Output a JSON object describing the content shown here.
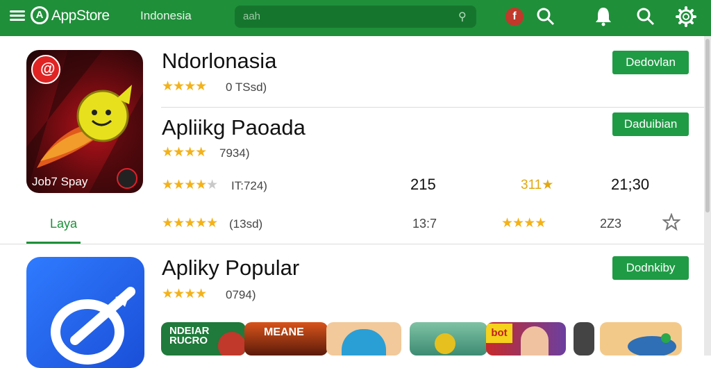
{
  "header": {
    "brand": "AppStore",
    "region": "Indonesia",
    "search_placeholder": "aah"
  },
  "icons": [
    "menu-icon",
    "logo-icon",
    "flag-icon",
    "search-icon",
    "bell-icon",
    "gear-icon",
    "star-icon"
  ],
  "colors": {
    "header": "#1f8f3a",
    "button": "#1f9b45",
    "star": "#f3b21a"
  },
  "apps": [
    {
      "title": "Ndorlonasia",
      "rating_count": "0 TSsd)",
      "button": "Dedovlan"
    },
    {
      "title": "Apliikg Paoada",
      "rating_count": "7934)",
      "button": "Daduibian",
      "icon_text": "Job7 Spay",
      "icon_badge": "@",
      "rows": [
        {
          "rating": "IT:724)",
          "value_a": "215",
          "value_b": "311★",
          "value_c": "21;30"
        },
        {
          "rating": "(13sd)",
          "value_a": "13:7",
          "value_c": "2Z3"
        }
      ],
      "tab": "Laya"
    },
    {
      "title": "Apliky Popular",
      "rating_count": "0794)",
      "button": "Dodnkiby"
    }
  ],
  "thumbs": [
    "NDEIAR RUCRO",
    "MEANE",
    "",
    "",
    "bot"
  ]
}
